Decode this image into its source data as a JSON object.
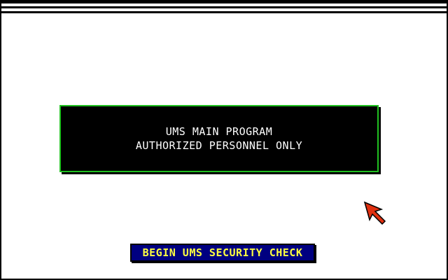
{
  "panel": {
    "line1": "UMS MAIN PROGRAM",
    "line2": "AUTHORIZED PERSONNEL ONLY"
  },
  "security_check": {
    "label": "BEGIN UMS SECURITY CHECK"
  },
  "pointer": {
    "icon": "arrow-pointer-icon"
  },
  "colors": {
    "background": "#ffffff",
    "panel_fill": "#000000",
    "panel_border": "#20c020",
    "panel_text": "#ffffff",
    "button_fill": "#000080",
    "button_text": "#ffff40",
    "cursor": "#e03010"
  }
}
